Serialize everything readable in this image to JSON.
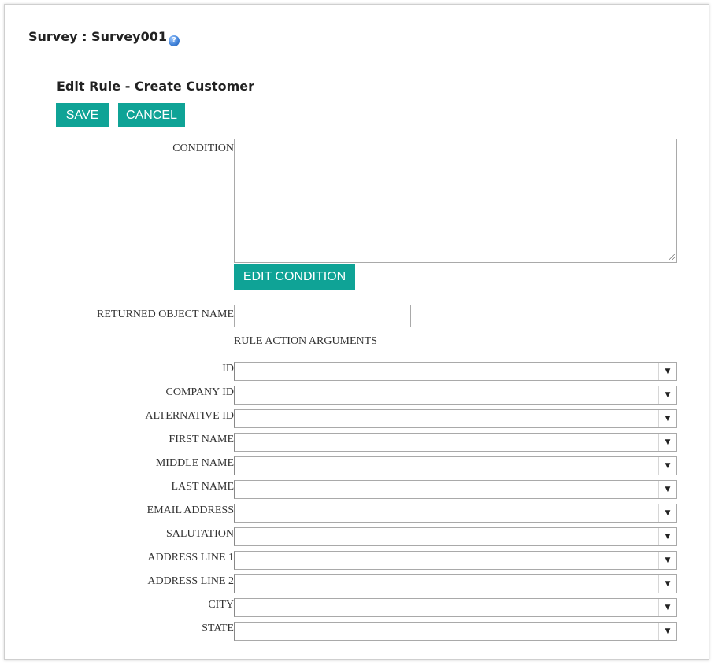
{
  "header": {
    "survey_title": "Survey : Survey001",
    "help_icon_glyph": "?"
  },
  "rule": {
    "title": "Edit Rule - Create Customer"
  },
  "actions": {
    "save_label": "SAVE",
    "cancel_label": "CANCEL"
  },
  "condition": {
    "label": "CONDITION",
    "value": "",
    "edit_button_label": "EDIT CONDITION"
  },
  "returned_object": {
    "label": "RETURNED OBJECT NAME",
    "value": ""
  },
  "arguments": {
    "heading": "RULE ACTION ARGUMENTS",
    "fields": [
      {
        "label": "ID",
        "value": ""
      },
      {
        "label": "COMPANY ID",
        "value": ""
      },
      {
        "label": "ALTERNATIVE ID",
        "value": ""
      },
      {
        "label": "FIRST NAME",
        "value": ""
      },
      {
        "label": "MIDDLE NAME",
        "value": ""
      },
      {
        "label": "LAST NAME",
        "value": ""
      },
      {
        "label": "EMAIL ADDRESS",
        "value": ""
      },
      {
        "label": "SALUTATION",
        "value": ""
      },
      {
        "label": "ADDRESS LINE 1",
        "value": ""
      },
      {
        "label": "ADDRESS LINE 2",
        "value": ""
      },
      {
        "label": "CITY",
        "value": ""
      },
      {
        "label": "STATE",
        "value": ""
      }
    ],
    "dropdown_arrow": "▼"
  },
  "colors": {
    "accent": "#0fa396",
    "border": "#a9a9a9",
    "text": "#333333"
  }
}
